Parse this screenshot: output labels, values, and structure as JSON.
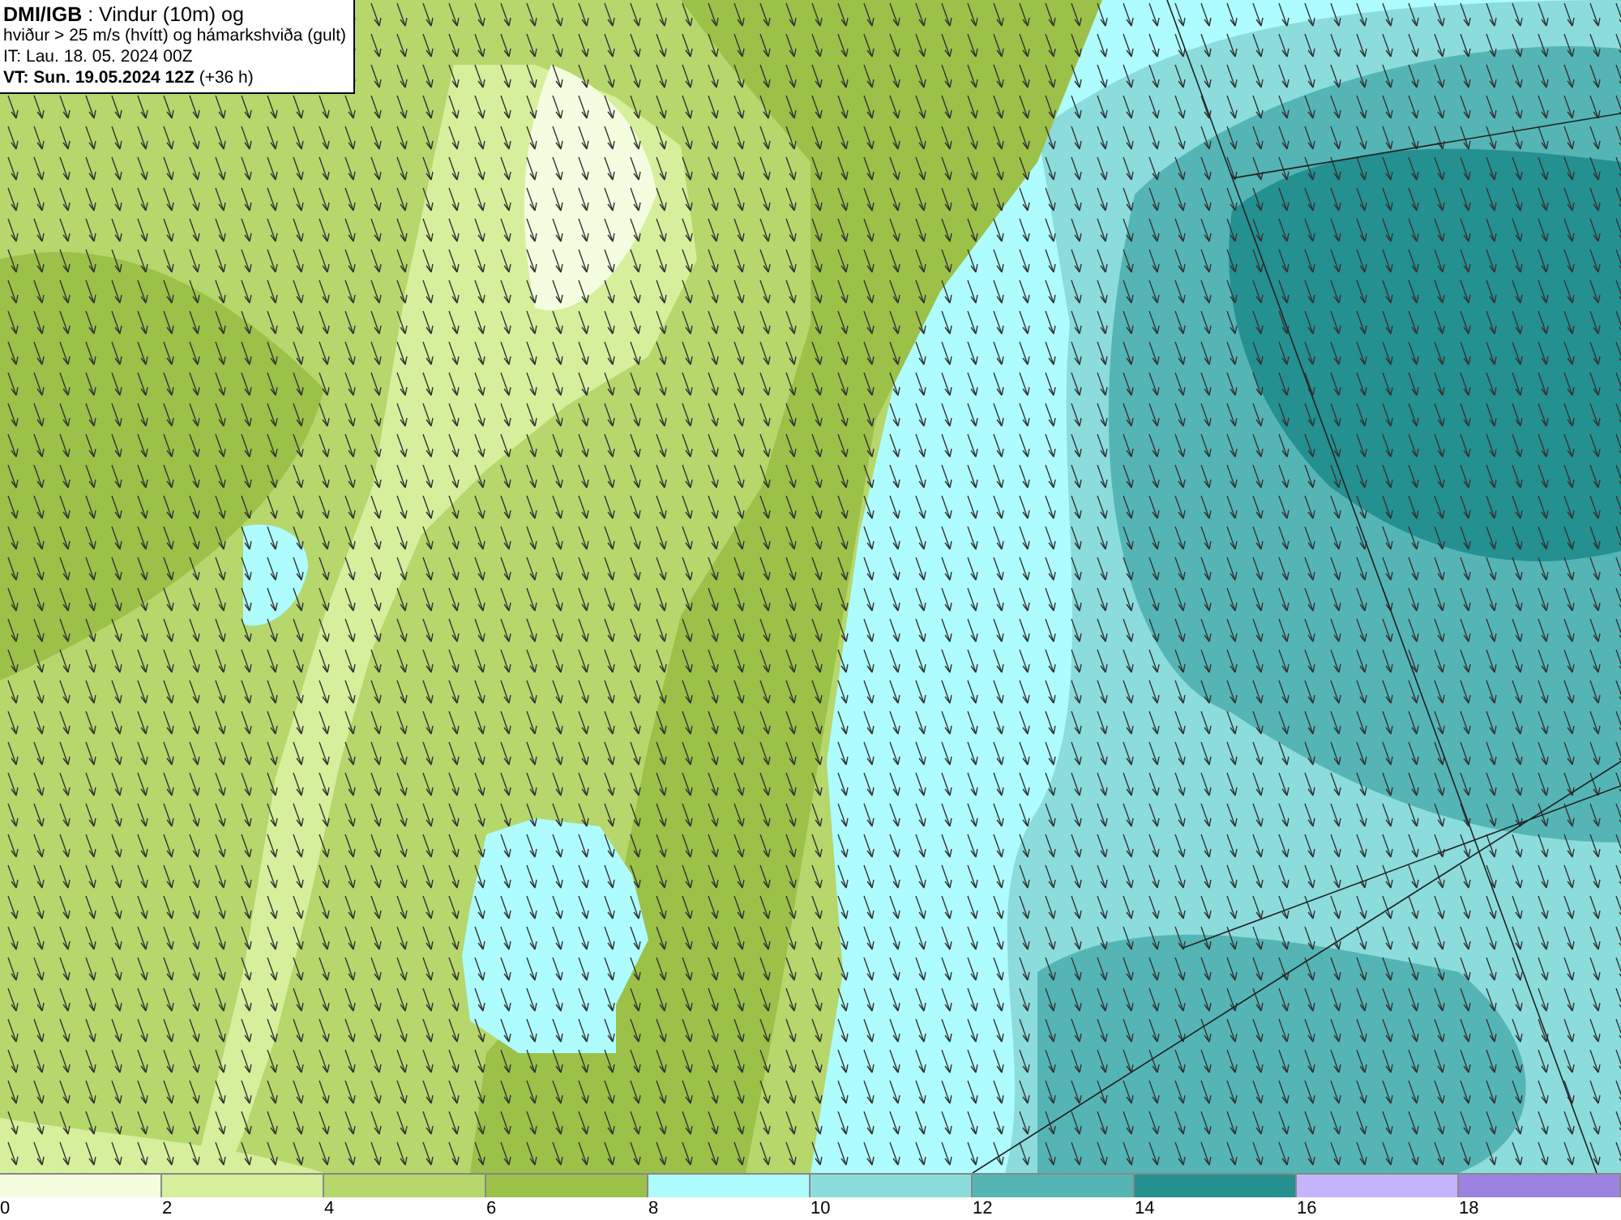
{
  "title_box": {
    "lines": [
      "**DMI/IGB** : Vindur (10m) og",
      "hviður > 25 m/s (hvítt) og hámarkshviða (gult)",
      "IT: Lau. 18. 05. 2024 00Z",
      "**VT: Sun. 19.05.2024 12Z** (+36 h)"
    ]
  },
  "legend": {
    "items": [
      {
        "color": "#f5fde0",
        "label": "0"
      },
      {
        "color": "#d6ef9c",
        "label": "2"
      },
      {
        "color": "#b5d76c",
        "label": "4"
      },
      {
        "color": "#9bc148",
        "label": "6"
      },
      {
        "color": "#aefcfe",
        "label": "8"
      },
      {
        "color": "#8cdcdc",
        "label": "10"
      },
      {
        "color": "#55b5b5",
        "label": "12"
      },
      {
        "color": "#249090",
        "label": "14"
      },
      {
        "color": "#c4b4fc",
        "label": "16"
      },
      {
        "color": "#9e82e0",
        "label": "18"
      }
    ]
  }
}
